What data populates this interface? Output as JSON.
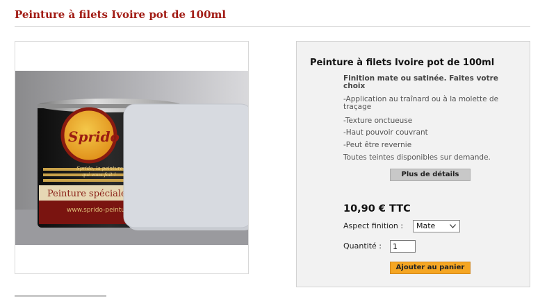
{
  "page": {
    "title": "Peinture à filets Ivoire pot de 100ml"
  },
  "product_image": {
    "alt": "Peinture à filets Ivoire pot de 100ml",
    "label_brand": "Sprido",
    "label_tagline": "Peinture spéciale pe",
    "label_url": "www.sprido-peinture",
    "label_small": "Sprido, la peinture qui vous fait !"
  },
  "info": {
    "title": "Peinture à filets Ivoire pot de 100ml",
    "lead": "Finition mate ou satinée. Faites votre choix",
    "features": [
      "-Application au traînard ou à la molette de traçage",
      "-Texture onctueuse",
      "-Haut pouvoir couvrant",
      "-Peut être revernie",
      "Toutes teintes disponibles sur demande."
    ],
    "details_label": "Plus de détails",
    "price": "10,90 € TTC",
    "aspect_label": "Aspect finition :",
    "aspect_value": "Mate",
    "quantity_label": "Quantité :",
    "quantity_value": "1",
    "add_to_cart_label": "Ajouter au panier"
  },
  "colors": {
    "title_red": "#a11b14",
    "panel_bg": "#f2f2f2",
    "cart_orange": "#f5a623"
  }
}
